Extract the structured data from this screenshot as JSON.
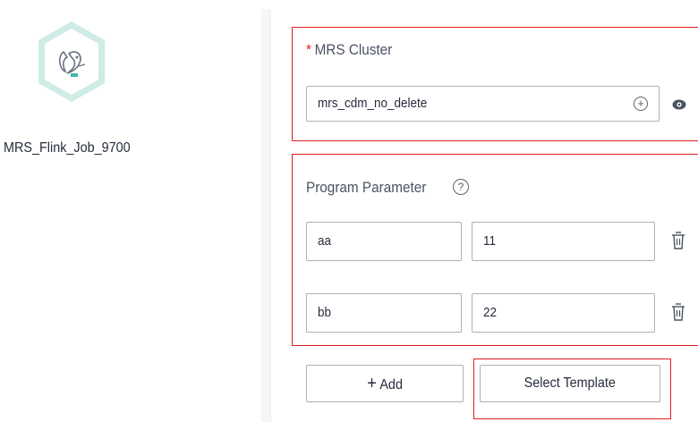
{
  "canvas": {
    "node": {
      "label": "MRS_Flink_Job_9700",
      "icon": "squirrel-icon"
    }
  },
  "form": {
    "cluster": {
      "required_mark": "*",
      "label": "MRS Cluster",
      "value": "mrs_cdm_no_delete",
      "add_icon": "plus-circle-icon",
      "view_icon": "eye-icon"
    },
    "program_parameter": {
      "label": "Program Parameter",
      "help_icon": "question-circle-icon",
      "rows": [
        {
          "key": "aa",
          "value": "11"
        },
        {
          "key": "bb",
          "value": "22"
        }
      ]
    },
    "buttons": {
      "add_label": "Add",
      "select_template_label": "Select Template"
    }
  },
  "colors": {
    "highlight": "#e02020",
    "node_ring": "#c7ebe3",
    "node_fill": "#e8f6f2",
    "border": "#adb0b8"
  }
}
